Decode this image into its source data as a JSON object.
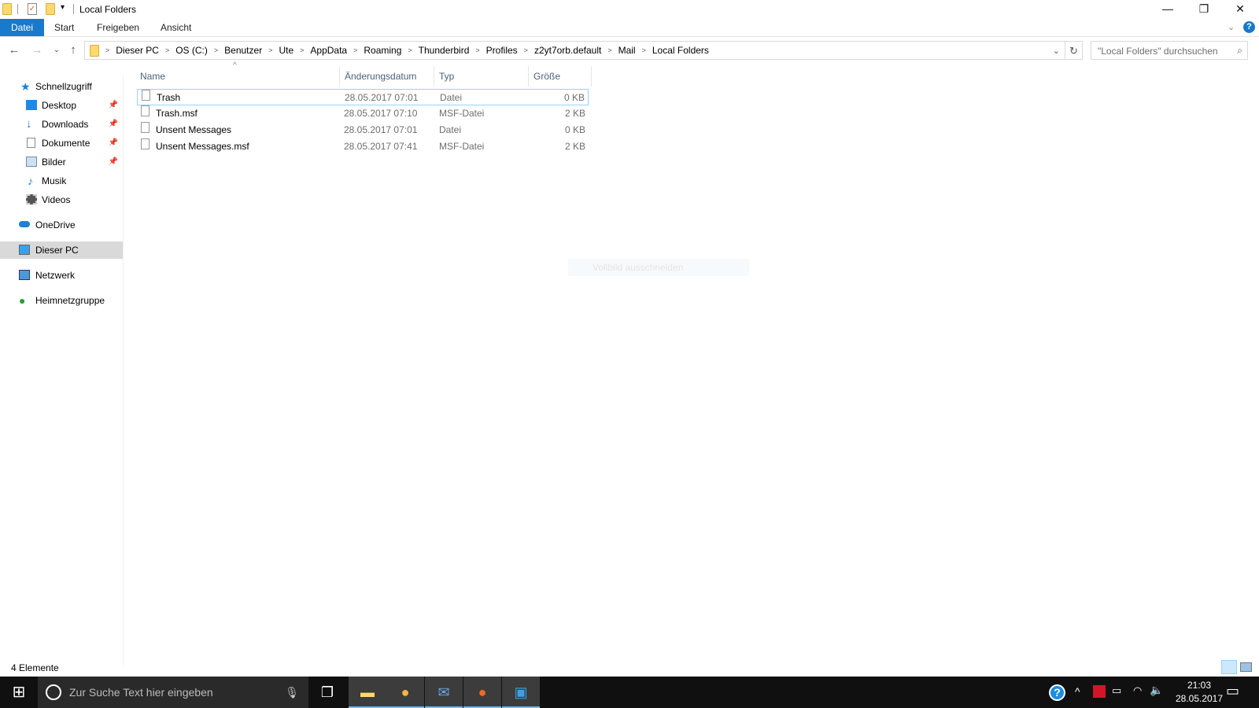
{
  "window": {
    "title": "Local Folders"
  },
  "ribbon": {
    "tabs": [
      "Datei",
      "Start",
      "Freigeben",
      "Ansicht"
    ]
  },
  "address": {
    "segments": [
      "Dieser PC",
      "OS (C:)",
      "Benutzer",
      "Ute",
      "AppData",
      "Roaming",
      "Thunderbird",
      "Profiles",
      "z2yt7orb.default",
      "Mail",
      "Local Folders"
    ]
  },
  "search": {
    "placeholder": "\"Local Folders\" durchsuchen"
  },
  "sidebar": {
    "items": [
      {
        "label": "Schnellzugriff",
        "pinned": false
      },
      {
        "label": "Desktop",
        "pinned": true
      },
      {
        "label": "Downloads",
        "pinned": true
      },
      {
        "label": "Dokumente",
        "pinned": true
      },
      {
        "label": "Bilder",
        "pinned": true
      },
      {
        "label": "Musik",
        "pinned": false
      },
      {
        "label": "Videos",
        "pinned": false
      },
      {
        "label": "OneDrive",
        "pinned": false
      },
      {
        "label": "Dieser PC",
        "pinned": false
      },
      {
        "label": "Netzwerk",
        "pinned": false
      },
      {
        "label": "Heimnetzgruppe",
        "pinned": false
      }
    ]
  },
  "columns": [
    "Name",
    "Änderungsdatum",
    "Typ",
    "Größe"
  ],
  "files": [
    {
      "name": "Trash",
      "date": "28.05.2017 07:01",
      "type": "Datei",
      "size": "0 KB"
    },
    {
      "name": "Trash.msf",
      "date": "28.05.2017 07:10",
      "type": "MSF-Datei",
      "size": "2 KB"
    },
    {
      "name": "Unsent Messages",
      "date": "28.05.2017 07:01",
      "type": "Datei",
      "size": "0 KB"
    },
    {
      "name": "Unsent Messages.msf",
      "date": "28.05.2017 07:41",
      "type": "MSF-Datei",
      "size": "2 KB"
    }
  ],
  "tooltip": "Vollbild ausschneiden",
  "status": "4 Elemente",
  "taskbar": {
    "search_placeholder": "Zur Suche Text hier eingeben",
    "time": "21:03",
    "date": "28.05.2017"
  }
}
